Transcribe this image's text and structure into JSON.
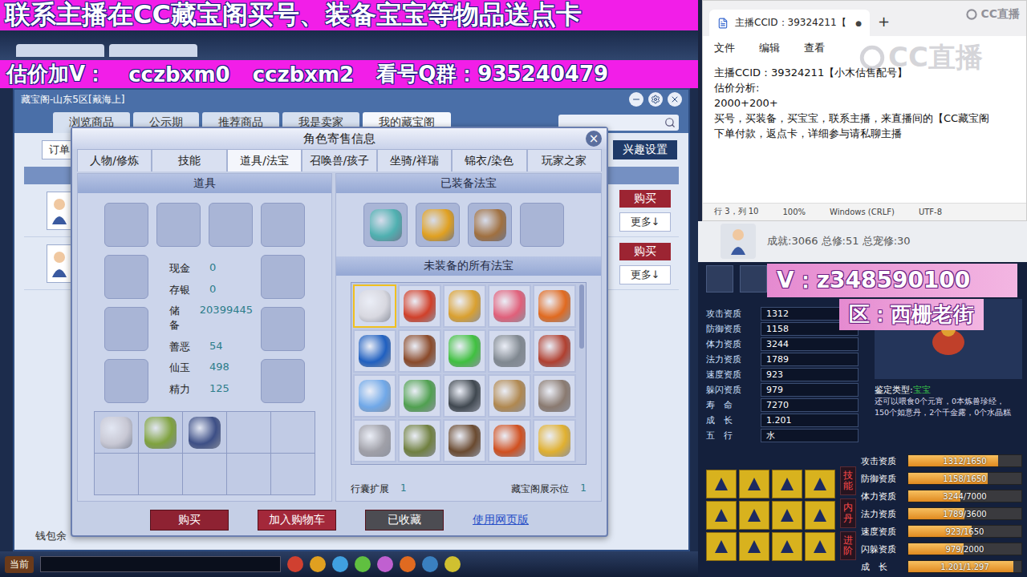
{
  "banners": {
    "top": "联系主播在CC藏宝阁买号、装备宝宝等物品送点卡",
    "contact": [
      "估价加V：",
      "cczbxm0",
      "cczbxm2",
      "看号Q群：935240479"
    ]
  },
  "game_window": {
    "title": "藏宝阁-山东5区[戴海上]",
    "tabs": [
      {
        "label": "浏览商品",
        "selected": false
      },
      {
        "label": "公示期",
        "selected": false
      },
      {
        "label": "推荐商品",
        "selected": false
      },
      {
        "label": "我是卖家",
        "selected": false
      },
      {
        "label": "我的藏宝阁",
        "selected": true
      }
    ],
    "order_label": "订单",
    "interest_button": "兴趣设置",
    "listing_rows": [
      {
        "buy": "购买",
        "more": "更多↓"
      },
      {
        "buy": "购买",
        "more": "更多↓"
      }
    ],
    "wallet_label": "钱包余",
    "toolbar_label": "当前"
  },
  "dialog": {
    "title": "角色寄售信息",
    "close": "×",
    "tabs": [
      {
        "label": "人物/修炼",
        "selected": false
      },
      {
        "label": "技能",
        "selected": false
      },
      {
        "label": "道具/法宝",
        "selected": true
      },
      {
        "label": "召唤兽/孩子",
        "selected": false
      },
      {
        "label": "坐骑/祥瑞",
        "selected": false
      },
      {
        "label": "锦衣/染色",
        "selected": false
      },
      {
        "label": "玩家之家",
        "selected": false
      }
    ],
    "items_panel": {
      "title": "道具",
      "equipment_slots": [
        {
          "filled": false
        },
        {
          "filled": false
        },
        {
          "filled": false
        },
        {
          "filled": false
        },
        {
          "filled": false
        },
        {
          "filled": false
        },
        {
          "filled": false
        },
        {
          "filled": false
        },
        {
          "filled": false
        },
        {
          "filled": false
        }
      ],
      "stats": [
        {
          "label": "现金",
          "value": "0"
        },
        {
          "label": "存银",
          "value": "0"
        },
        {
          "label": "储备",
          "value": "20399445"
        },
        {
          "label": "善恶",
          "value": "54"
        },
        {
          "label": "仙玉",
          "value": "498"
        },
        {
          "label": "精力",
          "value": "125"
        }
      ],
      "bag": [
        {
          "filled": true,
          "color": "#c8c8d4"
        },
        {
          "filled": true,
          "color": "#7fa23e"
        },
        {
          "filled": true,
          "color": "#3d4f86"
        },
        {
          "filled": false,
          "color": "#000000"
        },
        {
          "filled": false,
          "color": "#000000"
        },
        {
          "filled": false,
          "color": "#000000"
        },
        {
          "filled": false,
          "color": "#000000"
        },
        {
          "filled": false,
          "color": "#000000"
        },
        {
          "filled": false,
          "color": "#000000"
        },
        {
          "filled": false,
          "color": "#000000"
        }
      ]
    },
    "treasure_panel": {
      "equipped_title": "已装备法宝",
      "equipped": [
        {
          "filled": true,
          "color": "#4fb0b0"
        },
        {
          "filled": true,
          "color": "#e0a020"
        },
        {
          "filled": true,
          "color": "#a07040"
        },
        {
          "filled": false,
          "color": "#000000"
        }
      ],
      "unequipped_title": "未装备的所有法宝",
      "unequipped": [
        {
          "color": "#d8d8e0",
          "selected": true
        },
        {
          "color": "#d0402a",
          "selected": false
        },
        {
          "color": "#d9a030",
          "selected": false
        },
        {
          "color": "#e0607a",
          "selected": false
        },
        {
          "color": "#e06a20",
          "selected": false
        },
        {
          "color": "#2060c0",
          "selected": false
        },
        {
          "color": "#8a4a2a",
          "selected": false
        },
        {
          "color": "#40c040",
          "selected": false
        },
        {
          "color": "#808890",
          "selected": false
        },
        {
          "color": "#b04030",
          "selected": false
        },
        {
          "color": "#70a8e8",
          "selected": false
        },
        {
          "color": "#50a050",
          "selected": false
        },
        {
          "color": "#404850",
          "selected": false
        },
        {
          "color": "#b08850",
          "selected": false
        },
        {
          "color": "#8a7a70",
          "selected": false
        },
        {
          "color": "#a0a0a8",
          "selected": false
        },
        {
          "color": "#708040",
          "selected": false
        },
        {
          "color": "#6a4a30",
          "selected": false
        },
        {
          "color": "#d05020",
          "selected": false
        },
        {
          "color": "#e0b030",
          "selected": false
        }
      ],
      "bag_expand_label": "行囊扩展",
      "bag_expand_value": "1",
      "showcase_label": "藏宝阁展示位",
      "showcase_value": "1"
    },
    "buttons": [
      {
        "label": "购买",
        "kind": "buy"
      },
      {
        "label": "加入购物车",
        "kind": "cart"
      },
      {
        "label": "已收藏",
        "kind": "saved"
      }
    ],
    "web_link": "使用网页版"
  },
  "notepad": {
    "tab_title": "主播CCID：39324211【",
    "dirty_mark": "●",
    "new_tab": "+",
    "menu": [
      "文件",
      "编辑",
      "查看"
    ],
    "lines": [
      "主播CCID：39324211【小木估售配号】",
      "估价分析:",
      "2000+200+",
      "买号，买装备，买宝宝，联系主播，来直播间的【CC藏宝阁",
      "下单付款，返点卡，详细参与请私聊主播"
    ],
    "status": [
      "行 3，列 10",
      "100%",
      "Windows (CRLF)",
      "UTF-8"
    ],
    "watermark": [
      "CC直播",
      "CC直播"
    ]
  },
  "achievement": "成就:3066 总修:51 总宠修:30",
  "pet": {
    "promo_wechat": "V：z348590100",
    "promo_server": "区：西栅老街",
    "attributes": [
      {
        "label": "攻击资质",
        "value": "1312"
      },
      {
        "label": "防御资质",
        "value": "1158"
      },
      {
        "label": "体力资质",
        "value": "3244"
      },
      {
        "label": "法力资质",
        "value": "1789"
      },
      {
        "label": "速度资质",
        "value": "923"
      },
      {
        "label": "躲闪资质",
        "value": "979"
      },
      {
        "label": "寿　命",
        "value": "7270"
      },
      {
        "label": "成　长",
        "value": "1.201"
      },
      {
        "label": "五　行",
        "value": "水"
      }
    ],
    "type_label": "鉴定类型:",
    "type_value": "宝宝",
    "feed_text": [
      "还可以喂食0个元宵，0本炼兽珍经，",
      "150个如意丹，2个千金露，0个水晶糕"
    ],
    "skills": [
      {
        "filled": true
      },
      {
        "filled": true
      },
      {
        "filled": true
      },
      {
        "filled": true
      },
      {
        "filled": true
      },
      {
        "filled": true
      },
      {
        "filled": true
      },
      {
        "filled": true
      },
      {
        "filled": true
      },
      {
        "filled": true
      },
      {
        "filled": true
      },
      {
        "filled": true
      }
    ],
    "side_tabs": [
      "技能",
      "内丹",
      "进阶"
    ],
    "bars": [
      {
        "label": "攻击资质",
        "reading": "1312/1650",
        "level": 0.795
      },
      {
        "label": "防御资质",
        "reading": "1158/1650",
        "level": 0.702
      },
      {
        "label": "体力资质",
        "reading": "3244/7000",
        "level": 0.463
      },
      {
        "label": "法力资质",
        "reading": "1789/3600",
        "level": 0.497
      },
      {
        "label": "速度资质",
        "reading": "923/1650",
        "level": 0.559
      },
      {
        "label": "闪躲资质",
        "reading": "979/2000",
        "level": 0.49
      },
      {
        "label": "成　长",
        "reading": "1.201/1.297",
        "level": 0.926
      }
    ]
  }
}
